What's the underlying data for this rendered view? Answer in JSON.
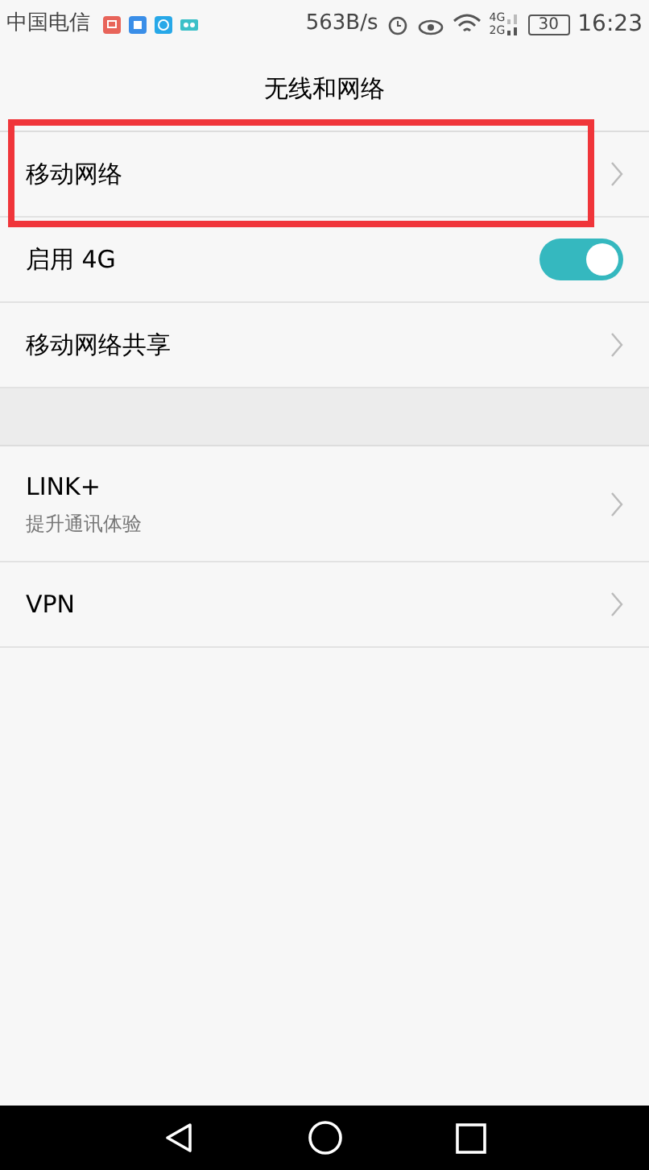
{
  "status_bar": {
    "carrier": "中国电信",
    "speed": "563B/s",
    "network_4g": "4G",
    "network_2g": "2G",
    "battery": "30",
    "time": "16:23"
  },
  "title": "无线和网络",
  "groups": [
    {
      "items": [
        {
          "kind": "link",
          "label": "移动网络",
          "highlighted": true
        },
        {
          "kind": "toggle",
          "label": "启用 4G",
          "on": true,
          "highlighted": false
        },
        {
          "kind": "link",
          "label": "移动网络共享",
          "highlighted": false
        }
      ]
    },
    {
      "items": [
        {
          "kind": "link",
          "label": "LINK+",
          "subtitle": "提升通讯体验",
          "highlighted": false
        },
        {
          "kind": "link",
          "label": "VPN",
          "highlighted": false
        }
      ]
    }
  ]
}
